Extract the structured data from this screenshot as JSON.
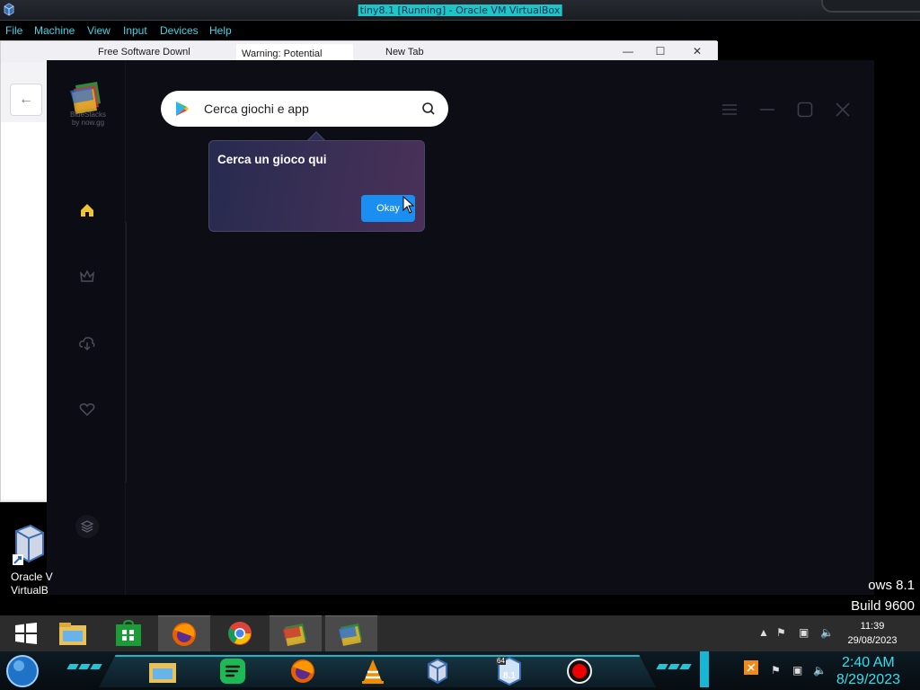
{
  "host": {
    "title": "tiny8.1 [Running] - Oracle VM VirtualBox",
    "menu": [
      "File",
      "Machine",
      "View",
      "Input",
      "Devices",
      "Help"
    ]
  },
  "firefox": {
    "tabs": [
      "Free Software Downl",
      "Warning: Potential",
      "New Tab"
    ],
    "controls": {
      "minimize": "—",
      "maximize": "☐",
      "close": "✕"
    },
    "back_glyph": "←"
  },
  "bluestacks": {
    "logo_line1": "BlueStacks",
    "logo_line2": "by now.gg",
    "search_placeholder": "Cerca giochi e app",
    "tooltip_text": "Cerca un gioco qui",
    "tooltip_button": "Okay",
    "nav_icons": [
      "home-icon",
      "crown-icon",
      "cloud-download-icon",
      "heart-icon",
      "layers-icon"
    ],
    "accent": "#f0c430"
  },
  "desktop": {
    "icon_label_line1": "Oracle V",
    "icon_label_line2": "VirtualB",
    "watermark_line1": "ows 8.1",
    "watermark_line2": "Build 9600"
  },
  "taskbar": {
    "time": "11:39",
    "date": "29/08/2023",
    "apps": [
      "windows-start",
      "file-explorer",
      "store",
      "firefox",
      "chrome",
      "bluestacks",
      "bluestacks"
    ]
  },
  "dock": {
    "time": "2:40 AM",
    "date": "8/29/2023",
    "badge": "8.1",
    "badge_small": "64"
  }
}
